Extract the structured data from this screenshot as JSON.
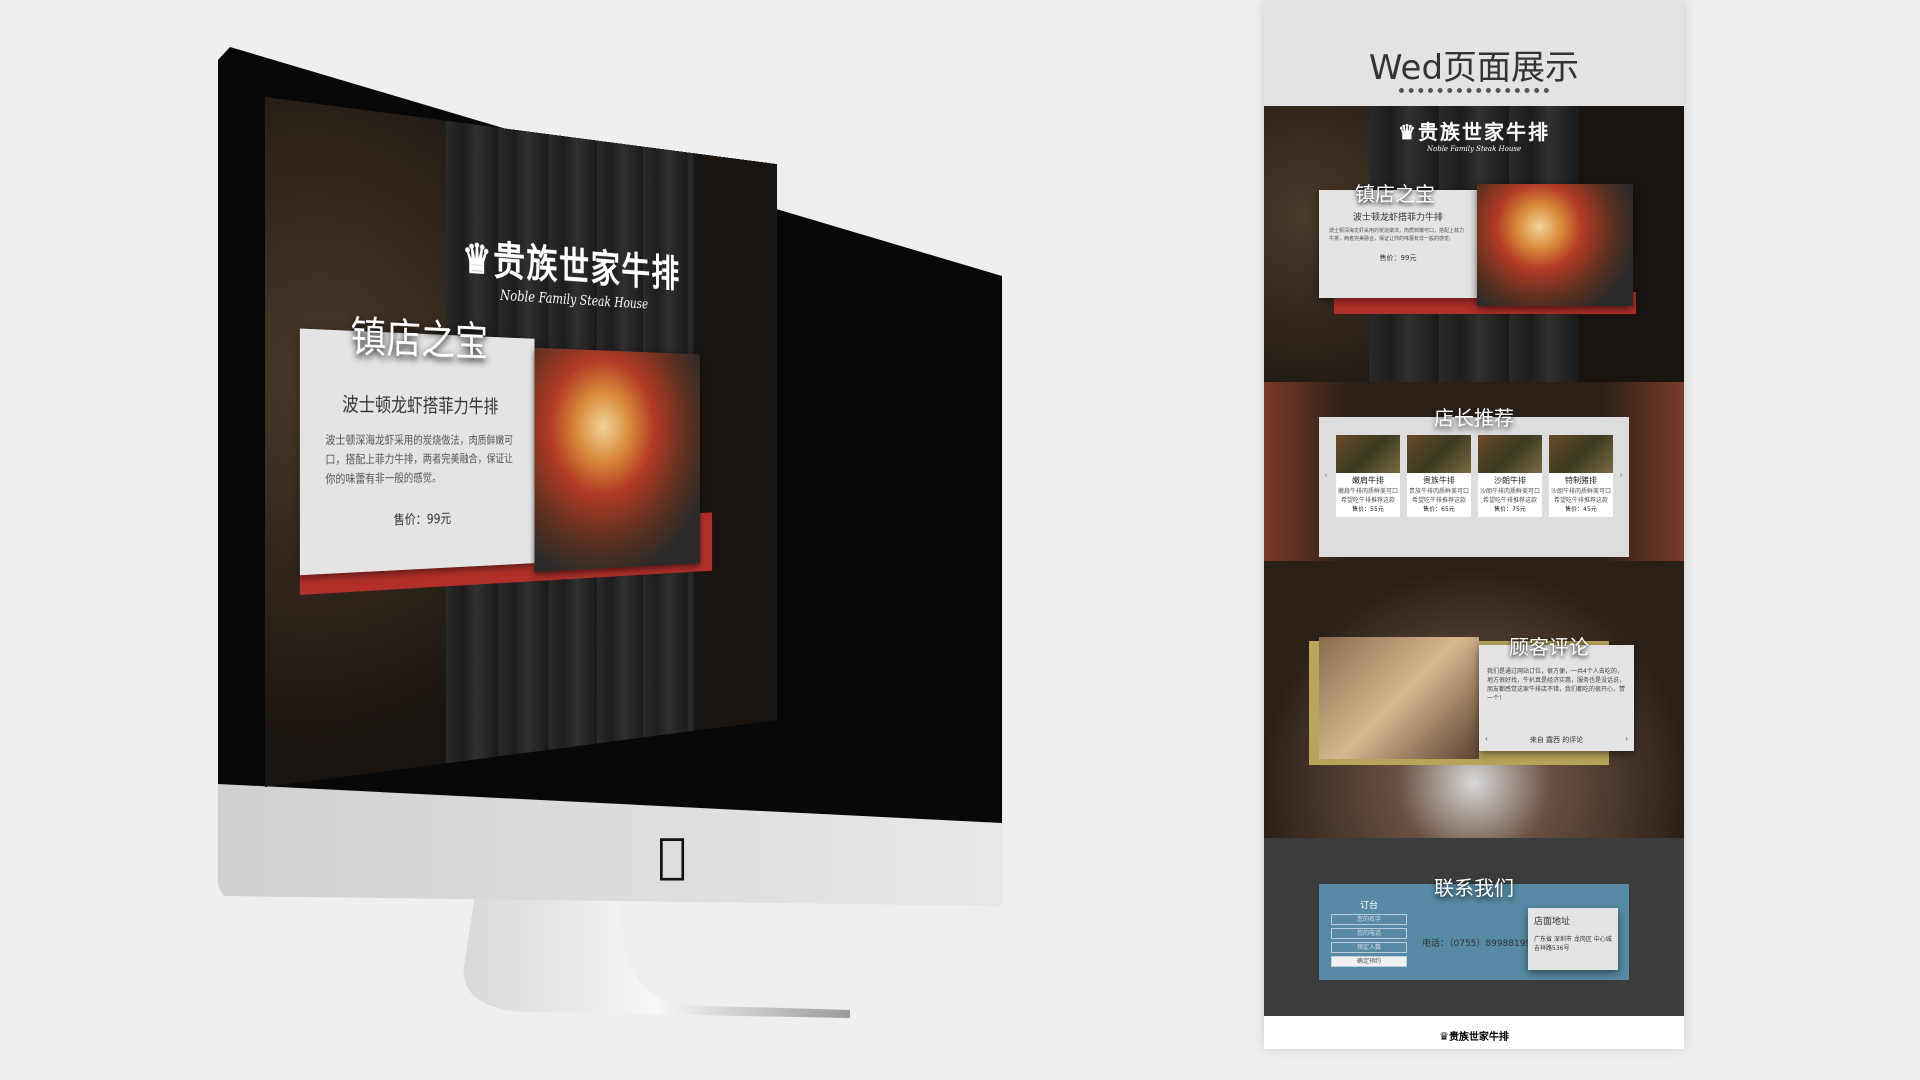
{
  "brand": {
    "name_cn": "贵族世家牛排",
    "name_en": "Noble Family Steak House"
  },
  "desktop": {
    "section_title": "镇店之宝",
    "dish_name": "波士顿龙虾搭菲力牛排",
    "dish_desc": "波士顿深海龙虾采用的炭烧做法，肉质鲜嫩可口，搭配上菲力牛排，两者完美融合，保证让你的味蕾有非一般的感觉。",
    "price": "售价：99元"
  },
  "panel": {
    "title": "Wed页面展示",
    "hero": {
      "section_title": "镇店之宝",
      "dish_name": "波士顿龙虾搭菲力牛排",
      "dish_desc": "波士顿深海龙虾采用的炭烧做法，肉质鲜嫩可口，搭配上菲力牛排，两者完美融合，保证让你的味蕾有非一般的感觉。",
      "price": "售价：99元"
    },
    "recommend": {
      "section_title": "店长推荐",
      "items": [
        {
          "name": "嫩肩牛排",
          "desc": "嫩肩牛排肉质鲜美可口 希望吃牛排推荐这款",
          "price": "售价：55元"
        },
        {
          "name": "贵族牛排",
          "desc": "贵族牛排肉质鲜美可口 希望吃牛排推荐这款",
          "price": "售价：65元"
        },
        {
          "name": "沙朗牛排",
          "desc": "沙朗牛排肉质鲜美可口 希望吃牛排推荐这款",
          "price": "售价：75元"
        },
        {
          "name": "特制猪排",
          "desc": "沙朗牛排肉质鲜美可口 希望吃牛排推荐这款",
          "price": "售价：45元"
        }
      ]
    },
    "review": {
      "section_title": "顾客评论",
      "text": "我们是通过网站订位，很方便，一共4个人去吃的，地方很好找，牛扒真是经济实惠，服务也是没话说，朋友都感觉这家牛排店不错，我们都吃的很开心，赞一个！",
      "source": "来自  露西  的评论"
    },
    "contact": {
      "section_title": "联系我们",
      "booking_title": "订台",
      "name_placeholder": "您的名字",
      "phone_placeholder": "您的电话",
      "people_placeholder": "预定人数",
      "submit": "确定预约",
      "phone": "电话：（0755）89988199",
      "address_title": "店面地址",
      "address": "广东省 深圳市 龙岗区 中心城 吉祥路536号"
    }
  },
  "colors": {
    "accent_red": "#b3302a",
    "contact_blue": "#5a93b0",
    "gold": "#b8a55a"
  }
}
